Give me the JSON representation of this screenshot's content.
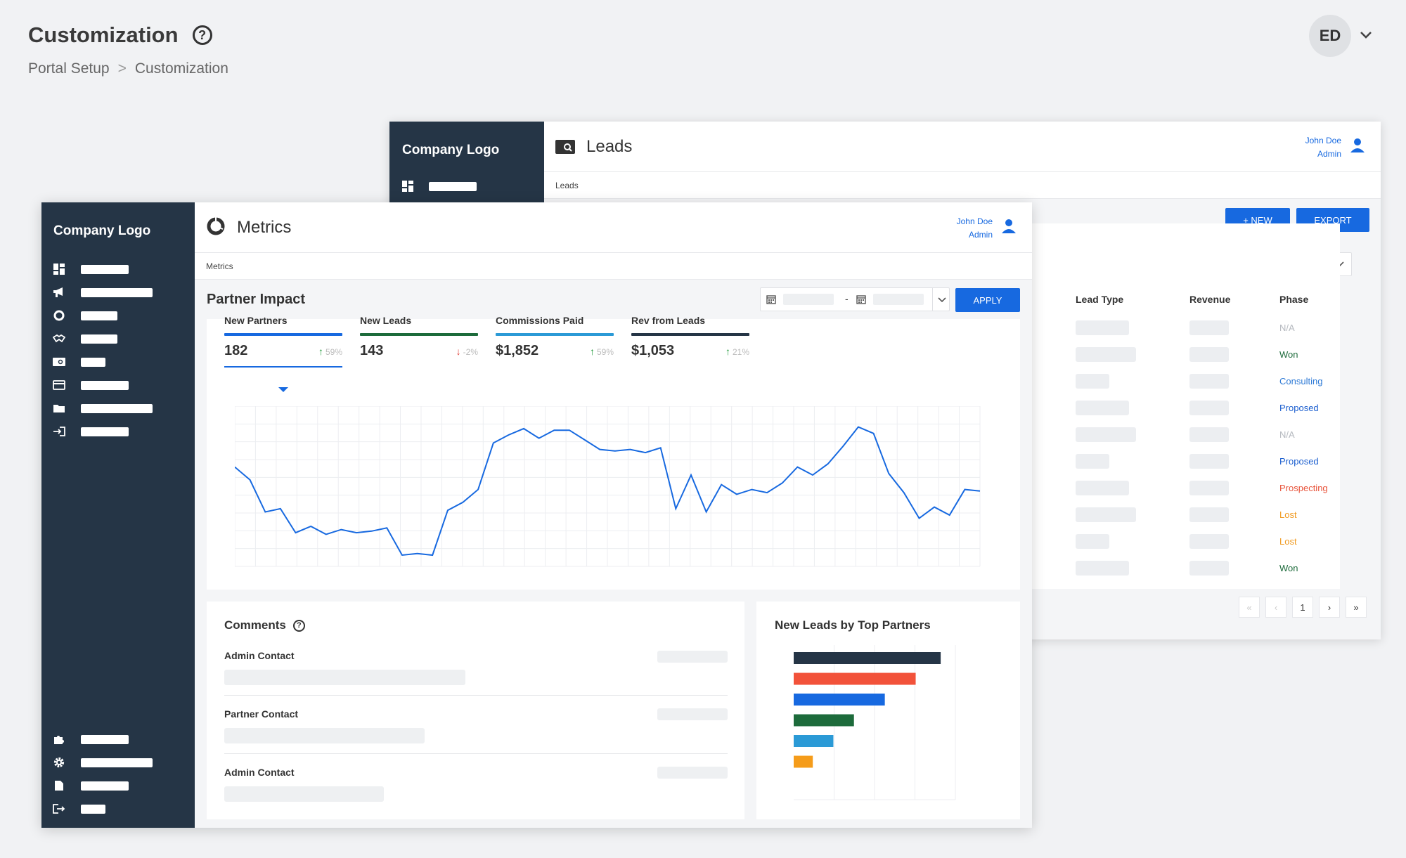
{
  "page": {
    "title": "Customization",
    "breadcrumb": [
      "Portal Setup",
      "Customization"
    ],
    "breadcrumb_sep": ">",
    "avatar_initials": "ED"
  },
  "leads_window": {
    "logo": "Company Logo",
    "title": "Leads",
    "subtitle": "Leads",
    "user": {
      "name": "John Doe",
      "role": "Admin"
    },
    "new_button": "+ NEW",
    "export_button": "EXPORT",
    "columns": [
      "Lead Type",
      "Revenue",
      "Phase"
    ],
    "phases": [
      {
        "label": "N/A",
        "color": "#b5b9bf"
      },
      {
        "label": "Won",
        "color": "#1d6b3b"
      },
      {
        "label": "Consulting",
        "color": "#2e7ad6"
      },
      {
        "label": "Proposed",
        "color": "#1c5fcf"
      },
      {
        "label": "N/A",
        "color": "#b5b9bf"
      },
      {
        "label": "Proposed",
        "color": "#1c5fcf"
      },
      {
        "label": "Prospecting",
        "color": "#e8533a"
      },
      {
        "label": "Lost",
        "color": "#f09a20"
      },
      {
        "label": "Lost",
        "color": "#f09a20"
      },
      {
        "label": "Won",
        "color": "#1d6b3b"
      }
    ],
    "pager": {
      "first": "«",
      "prev": "‹",
      "page": "1",
      "next": "›",
      "last": "»"
    }
  },
  "metrics_window": {
    "logo": "Company Logo",
    "title": "Metrics",
    "subtitle": "Metrics",
    "user": {
      "name": "John Doe",
      "role": "Admin"
    },
    "section_title": "Partner Impact",
    "date_sep": "-",
    "apply_button": "APPLY",
    "kpis": [
      {
        "label": "New Partners",
        "value": "182",
        "change": "59%",
        "dir": "up",
        "color": "#1769e0"
      },
      {
        "label": "New Leads",
        "value": "143",
        "change": "-2%",
        "dir": "down",
        "color": "#1d6b3b"
      },
      {
        "label": "Commissions Paid",
        "value": "$1,852",
        "change": "59%",
        "dir": "up",
        "color": "#2b9ad6"
      },
      {
        "label": "Rev from Leads",
        "value": "$1,053",
        "change": "21%",
        "dir": "up",
        "color": "#253546"
      }
    ],
    "comments": {
      "title": "Comments",
      "items": [
        "Admin Contact",
        "Partner Contact",
        "Admin Contact"
      ]
    },
    "top_partners_title": "New Leads by Top Partners"
  },
  "chart_data": [
    {
      "type": "line",
      "series": [
        {
          "color": "#1769e0",
          "values": [
            62,
            54,
            34,
            36,
            21,
            25,
            20,
            23,
            21,
            22,
            24,
            7,
            8,
            7,
            35,
            40,
            48,
            77,
            82,
            86,
            80,
            85,
            85,
            79,
            73,
            72,
            73,
            71,
            74,
            36,
            57,
            34,
            51,
            45,
            48,
            46,
            52,
            62,
            57,
            64,
            75,
            87,
            83,
            58,
            46,
            30,
            37,
            32,
            48,
            47
          ]
        }
      ],
      "ylim": [
        0,
        100
      ],
      "grid": true
    },
    {
      "type": "bar",
      "title": "New Leads by Top Partners",
      "orientation": "horizontal",
      "values": [
        100,
        83,
        62,
        41,
        27,
        13
      ],
      "colors": [
        "#253546",
        "#f2523a",
        "#1769e0",
        "#1d6b3b",
        "#2b9ad6",
        "#f59c1a"
      ],
      "xlim": [
        0,
        110
      ],
      "grid": true
    }
  ],
  "icons": {
    "help": "?",
    "chevron": "chevron-down-icon",
    "arrow_up": "↑",
    "arrow_down": "↓"
  }
}
